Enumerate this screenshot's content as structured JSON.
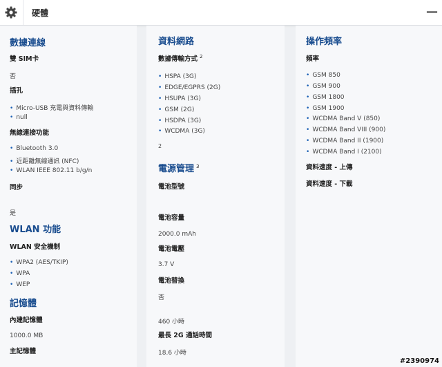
{
  "header": {
    "title": "硬體"
  },
  "columns": {
    "data_connectivity": {
      "heading": "數據連線",
      "dual_sim_label": "雙 SIM卡",
      "dual_sim_value": "否",
      "slots_label": "插孔",
      "slots": [
        "Micro-USB 充電與資料傳輸",
        "null"
      ],
      "wireless_label": "無線連接功能",
      "wireless": [
        "Bluetooth 3.0",
        "近距離無線通訊 (NFC)",
        "WLAN IEEE 802.11 b/g/n"
      ],
      "sync_label": "同步",
      "sync_value": "是",
      "wlan_heading": "WLAN 功能",
      "wlan_security_label": "WLAN 安全機制",
      "wlan_security": [
        "WPA2 (AES/TKIP)",
        "WPA",
        "WEP"
      ],
      "memory_heading": "記憶體",
      "internal_memory_label": "內建記憶體",
      "internal_memory_value": "1000.0 MB",
      "main_memory_label": "主記憶體"
    },
    "data_network": {
      "heading": "資料網路",
      "transfer_label": "數據傳輸方式",
      "transfer_sup": "2",
      "transfer": [
        "HSPA (3G)",
        "EDGE/EGPRS (2G)",
        "HSUPA (3G)",
        "GSM (2G)",
        "HSDPA (3G)",
        "WCDMA (3G)"
      ],
      "footnote": "2",
      "power_heading": "電源管理",
      "power_sup": "3",
      "battery_type_label": "電池型號",
      "battery_capacity_label": "電池容量",
      "battery_capacity_value": "2000.0 mAh",
      "battery_voltage_label": "電池電壓",
      "battery_voltage_value": "3.7 V",
      "battery_replace_label": "電池替換",
      "battery_replace_value": "否",
      "standby_value": "460 小時",
      "talk_time_label": "最長 2G 通話時間",
      "talk_time_value": "18.6 小時"
    },
    "operating_freq": {
      "heading": "操作頻率",
      "freq_label": "頻率",
      "freqs": [
        "GSM 850",
        "GSM 900",
        "GSM 1800",
        "GSM 1900",
        "WCDMA Band V (850)",
        "WCDMA Band VIII (900)",
        "WCDMA Band II (1900)",
        "WCDMA Band I (2100)"
      ],
      "upload_label": "資料速度 - 上傳",
      "download_label": "資料速度 - 下載"
    }
  },
  "watermark": "#2390974",
  "colors": {
    "heading": "#1a4d8f",
    "bullet": "#1a5fb4",
    "background": "#eef0f3",
    "panel": "#f7f8fa"
  }
}
